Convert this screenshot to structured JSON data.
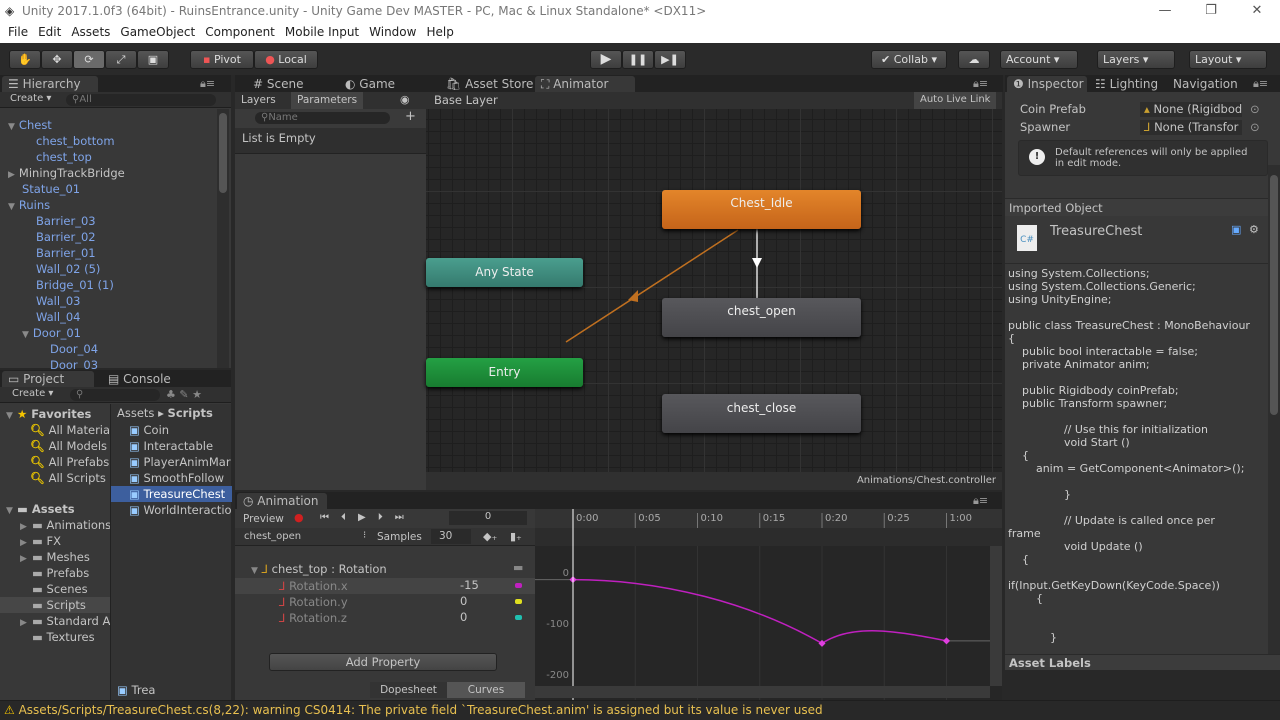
{
  "title": "Unity 2017.1.0f3 (64bit) - RuinsEntrance.unity - Unity Game Dev MASTER - PC, Mac & Linux Standalone* <DX11>",
  "menu": [
    "File",
    "Edit",
    "Assets",
    "GameObject",
    "Component",
    "Mobile Input",
    "Window",
    "Help"
  ],
  "toolbar": {
    "tools": [
      "hand",
      "move",
      "rotate",
      "scale",
      "rect"
    ],
    "pivot": "Pivot",
    "local": "Local",
    "collab": "Collab",
    "account": "Account",
    "layers": "Layers",
    "layout": "Layout"
  },
  "hierarchy": {
    "tab": "Hierarchy",
    "create": "Create",
    "search_placeholder": "All",
    "items": [
      {
        "label": "Chest",
        "indent": 0,
        "expanded": true,
        "prefab": true
      },
      {
        "label": "chest_bottom",
        "indent": 1,
        "prefab": true
      },
      {
        "label": "chest_top",
        "indent": 1,
        "prefab": true
      },
      {
        "label": "MiningTrackBridge",
        "indent": 0,
        "collapsed": true,
        "prefab": false
      },
      {
        "label": "Statue_01",
        "indent": 0,
        "prefab": true
      },
      {
        "label": "Ruins",
        "indent": 0,
        "expanded": true,
        "prefab": true
      },
      {
        "label": "Barrier_03",
        "indent": 1,
        "prefab": true
      },
      {
        "label": "Barrier_02",
        "indent": 1,
        "prefab": true
      },
      {
        "label": "Barrier_01",
        "indent": 1,
        "prefab": true
      },
      {
        "label": "Wall_02 (5)",
        "indent": 1,
        "prefab": true
      },
      {
        "label": "Bridge_01 (1)",
        "indent": 1,
        "prefab": true
      },
      {
        "label": "Wall_03",
        "indent": 1,
        "prefab": true
      },
      {
        "label": "Wall_04",
        "indent": 1,
        "prefab": true
      },
      {
        "label": "Door_01",
        "indent": 1,
        "expanded": true,
        "prefab": true
      },
      {
        "label": "Door_04",
        "indent": 2,
        "prefab": true
      },
      {
        "label": "Door_03",
        "indent": 2,
        "prefab": true
      }
    ]
  },
  "project": {
    "tabs": [
      "Project",
      "Console"
    ],
    "create": "Create",
    "favorites": {
      "label": "Favorites",
      "items": [
        "All Materia",
        "All Models",
        "All Prefabs",
        "All Scripts"
      ]
    },
    "assets": {
      "label": "Assets",
      "items": [
        {
          "label": "Animations",
          "arrow": true
        },
        {
          "label": "FX",
          "arrow": true
        },
        {
          "label": "Meshes",
          "arrow": true
        },
        {
          "label": "Prefabs"
        },
        {
          "label": "Scenes"
        },
        {
          "label": "Scripts",
          "selected": true
        },
        {
          "label": "Standard A",
          "arrow": true
        },
        {
          "label": "Textures"
        }
      ]
    },
    "breadcrumb": [
      "Assets",
      "Scripts"
    ],
    "files": [
      "Coin",
      "Interactable",
      "PlayerAnimMar",
      "SmoothFollow",
      "TreasureChest",
      "WorldInteractio"
    ],
    "selected_file": "TreasureChest",
    "footer": "Trea"
  },
  "center_tabs": [
    "Scene",
    "Game",
    "Asset Store",
    "Animator"
  ],
  "animator": {
    "sub_tabs": [
      "Layers",
      "Parameters"
    ],
    "name_placeholder": "Name",
    "list_empty": "List is Empty",
    "layer": "Base Layer",
    "auto_live_link": "Auto Live Link",
    "path": "Animations/Chest.controller",
    "states": {
      "chest_idle": "Chest_Idle",
      "chest_open": "chest_open",
      "chest_close": "chest_close",
      "any_state": "Any State",
      "entry": "Entry"
    },
    "colors": {
      "default_state": "#d8731f",
      "any_state": "#3d8a7b",
      "entry": "#1e8a3a",
      "state": "#4a4a4e"
    }
  },
  "animation": {
    "tab": "Animation",
    "preview": "Preview",
    "frame": "0",
    "clip": "chest_open",
    "samples_label": "Samples",
    "samples": "30",
    "ticks": [
      "0:00",
      "0:05",
      "0:10",
      "0:15",
      "0:20",
      "0:25",
      "1:00"
    ],
    "value_ticks": [
      "0",
      "-100",
      "-200"
    ],
    "property": "chest_top : Rotation",
    "channels": [
      {
        "label": "Rotation.x",
        "value": "-15",
        "color": "#c020c0"
      },
      {
        "label": "Rotation.y",
        "value": "0",
        "color": "#e0e020"
      },
      {
        "label": "Rotation.z",
        "value": "0",
        "color": "#20c0b0"
      }
    ],
    "add_property": "Add Property",
    "modes": [
      "Dopesheet",
      "Curves"
    ],
    "curve_x": {
      "keys": [
        {
          "frame": 0,
          "value": -15
        },
        {
          "frame": 20,
          "value": -140
        },
        {
          "frame": 30,
          "value": -135
        }
      ]
    }
  },
  "inspector": {
    "tabs": [
      "Inspector",
      "Lighting",
      "Navigation"
    ],
    "fields": [
      {
        "label": "Coin Prefab",
        "value": "None (Rigidbod"
      },
      {
        "label": "Spawner",
        "value": "None (Transfor"
      }
    ],
    "info": "Default references will only be applied in edit mode.",
    "imported": "Imported Object",
    "script_name": "TreasureChest",
    "code": [
      "using System.Collections;",
      "using System.Collections.Generic;",
      "using UnityEngine;",
      "",
      "public class TreasureChest : MonoBehaviour",
      "{",
      "    public bool interactable = false;",
      "    private Animator anim;",
      "",
      "    public Rigidbody coinPrefab;",
      "    public Transform spawner;",
      "",
      "                // Use this for initialization",
      "                void Start ()",
      "    {",
      "        anim = GetComponent<Animator>();",
      "",
      "                }",
      "",
      "                // Update is called once per",
      "frame",
      "                void Update ()",
      "    {",
      "",
      "if(Input.GetKeyDown(KeyCode.Space))",
      "        {",
      "",
      "",
      "            }"
    ],
    "asset_labels": "Asset Labels"
  },
  "status": "Assets/Scripts/TreasureChest.cs(8,22): warning CS0414: The private field `TreasureChest.anim' is assigned but its value is never used"
}
